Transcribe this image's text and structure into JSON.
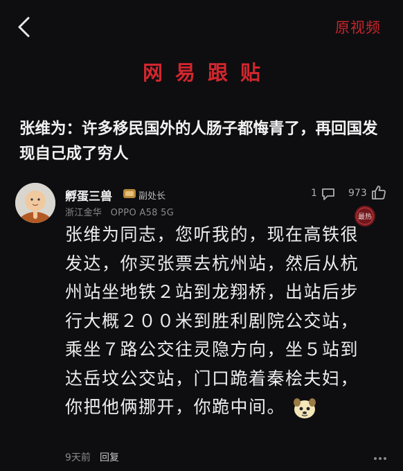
{
  "header": {
    "back_icon": "chevron-left-icon",
    "original_video": "原视频",
    "brand_title": "网易跟贴"
  },
  "headline": "张维为：许多移民国外的人肠子都悔青了，再回国发现自己成了穷人",
  "comment": {
    "username": "孵蛋三兽",
    "rank": "副处长",
    "location": "浙江金华",
    "device": "OPPO A58 5G",
    "reply_count": "1",
    "like_count": "973",
    "hot_badge": "最热",
    "body": "张维为同志，您听我的，现在高铁很发达，你买张票去杭州站，然后从杭州站坐地铁２站到龙翔桥，出站后步行大概２００米到胜利剧院公交站，乘坐７路公交往灵隐方向，坐５站到达岳坟公交站，门口跪着秦桧夫妇，你把他俩挪开，你跪中间。",
    "time_ago": "9天前",
    "reply_label": "回复"
  },
  "colors": {
    "background": "#0e0e10",
    "accent_red": "#d2262e",
    "text_primary": "#f2f2f2",
    "text_secondary": "#8a8a8a"
  }
}
